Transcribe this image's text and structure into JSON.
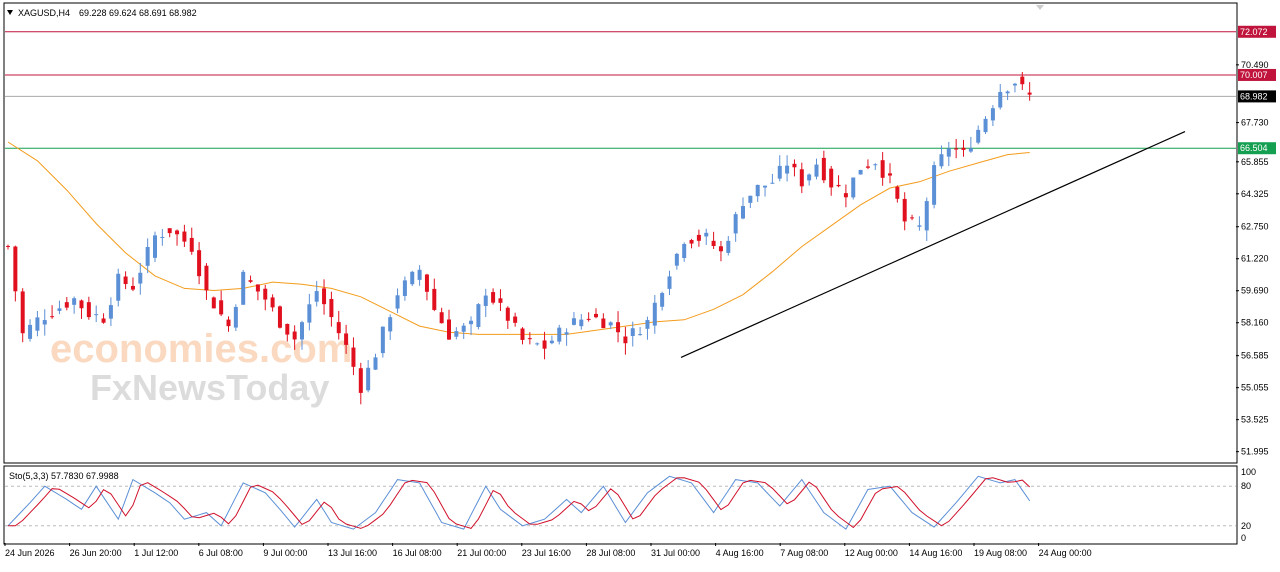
{
  "header": {
    "symbol": "XAGUSD,H4",
    "ohlc": "69.228 69.624 68.691 68.982"
  },
  "watermark": {
    "line1": "economies.com",
    "line2": "FxNewsToday"
  },
  "colors": {
    "bull": "#5b8fd6",
    "bear": "#e0101e",
    "ma": "#f39c1c",
    "resistance": "#c0143c",
    "support": "#14a050",
    "trendline": "#000000",
    "stoch_main": "#5b8fd6",
    "stoch_signal": "#d0102a"
  },
  "chart_data": [
    {
      "type": "candlestick",
      "price_axis": {
        "range": [
          51.5,
          73.4
        ],
        "ticks": [
          "70.490",
          "67.730",
          "65.855",
          "64.325",
          "62.750",
          "61.220",
          "59.690",
          "58.160",
          "56.585",
          "55.055",
          "53.525",
          "51.995"
        ]
      },
      "time_axis": {
        "labels": [
          "24 Jun 2026",
          "26 Jun 20:00",
          "1 Jul 12:00",
          "6 Jul 08:00",
          "9 Jul 00:00",
          "13 Jul 16:00",
          "16 Jul 08:00",
          "21 Jul 00:00",
          "23 Jul 16:00",
          "28 Jul 08:00",
          "31 Jul 00:00",
          "4 Aug 16:00",
          "7 Aug 08:00",
          "12 Aug 00:00",
          "14 Aug 16:00",
          "19 Aug 08:00",
          "24 Aug 00:00"
        ]
      },
      "levels": [
        {
          "price": 72.072,
          "label": "72.072",
          "role": "resistance"
        },
        {
          "price": 70.007,
          "label": "70.007",
          "role": "resistance"
        },
        {
          "price": 68.982,
          "label": "68.982",
          "role": "current"
        },
        {
          "price": 66.504,
          "label": "66.504",
          "role": "support"
        }
      ],
      "trendline": [
        [
          56.5,
          0.676
        ],
        [
          67.3,
          1.0
        ]
      ],
      "price_path": [
        [
          0,
          61.8
        ],
        [
          2,
          57.6
        ],
        [
          4,
          58.3
        ],
        [
          7,
          58.9
        ],
        [
          9,
          59.3
        ],
        [
          11,
          58.6
        ],
        [
          13,
          58.4
        ],
        [
          15,
          60.2
        ],
        [
          17,
          59.9
        ],
        [
          20,
          62.3
        ],
        [
          22,
          62.6
        ],
        [
          25,
          61.8
        ],
        [
          27,
          59.6
        ],
        [
          30,
          58.0
        ],
        [
          32,
          60.4
        ],
        [
          35,
          59.3
        ],
        [
          37,
          58.2
        ],
        [
          39,
          57.4
        ],
        [
          42,
          59.7
        ],
        [
          44,
          58.4
        ],
        [
          46,
          57.0
        ],
        [
          48,
          55.1
        ],
        [
          50,
          56.7
        ],
        [
          53,
          59.6
        ],
        [
          56,
          60.7
        ],
        [
          58,
          58.8
        ],
        [
          60,
          57.6
        ],
        [
          63,
          58.0
        ],
        [
          65,
          59.7
        ],
        [
          68,
          58.4
        ],
        [
          70,
          57.3
        ],
        [
          73,
          57.0
        ],
        [
          76,
          58.0
        ],
        [
          79,
          58.5
        ],
        [
          82,
          58.1
        ],
        [
          84,
          57.4
        ],
        [
          87,
          58.2
        ],
        [
          89,
          59.9
        ],
        [
          92,
          62.2
        ],
        [
          95,
          62.2
        ],
        [
          97,
          61.5
        ],
        [
          100,
          64.0
        ],
        [
          102,
          64.6
        ],
        [
          104,
          64.9
        ],
        [
          106,
          65.8
        ],
        [
          108,
          64.9
        ],
        [
          110,
          65.8
        ],
        [
          112,
          64.8
        ],
        [
          114,
          64.4
        ],
        [
          116,
          65.6
        ],
        [
          118,
          65.9
        ],
        [
          120,
          64.9
        ],
        [
          122,
          63.0
        ],
        [
          124,
          62.7
        ],
        [
          126,
          65.4
        ],
        [
          128,
          66.6
        ],
        [
          130,
          66.2
        ],
        [
          133,
          68.0
        ],
        [
          135,
          69.3
        ],
        [
          137,
          69.7
        ],
        [
          139,
          68.98
        ]
      ],
      "moving_average": [
        [
          0,
          66.8
        ],
        [
          4,
          65.9
        ],
        [
          8,
          64.5
        ],
        [
          12,
          62.9
        ],
        [
          16,
          61.5
        ],
        [
          20,
          60.4
        ],
        [
          24,
          59.8
        ],
        [
          28,
          59.7
        ],
        [
          32,
          59.8
        ],
        [
          36,
          60.1
        ],
        [
          40,
          60.0
        ],
        [
          44,
          59.8
        ],
        [
          48,
          59.4
        ],
        [
          52,
          58.7
        ],
        [
          56,
          58.0
        ],
        [
          60,
          57.7
        ],
        [
          64,
          57.6
        ],
        [
          68,
          57.6
        ],
        [
          72,
          57.6
        ],
        [
          76,
          57.6
        ],
        [
          80,
          57.8
        ],
        [
          84,
          58.0
        ],
        [
          88,
          58.2
        ],
        [
          92,
          58.3
        ],
        [
          96,
          58.8
        ],
        [
          100,
          59.5
        ],
        [
          104,
          60.6
        ],
        [
          108,
          61.8
        ],
        [
          112,
          62.8
        ],
        [
          116,
          63.8
        ],
        [
          120,
          64.6
        ],
        [
          124,
          64.9
        ],
        [
          128,
          65.4
        ],
        [
          132,
          65.8
        ],
        [
          136,
          66.2
        ],
        [
          139,
          66.3
        ]
      ]
    },
    {
      "type": "line",
      "indicator": "Sto(5,3,3)",
      "label": "Sto(5,3,3) 57.7830 67.9988",
      "levels": {
        "upper": "80",
        "lower": "20",
        "max": "100",
        "min": "0"
      },
      "ylim": [
        0,
        100
      ],
      "series_points": [
        [
          0,
          20
        ],
        [
          3,
          55
        ],
        [
          5,
          80
        ],
        [
          8,
          60
        ],
        [
          10,
          45
        ],
        [
          12,
          80
        ],
        [
          15,
          30
        ],
        [
          17,
          90
        ],
        [
          20,
          70
        ],
        [
          22,
          55
        ],
        [
          24,
          30
        ],
        [
          27,
          40
        ],
        [
          29,
          20
        ],
        [
          32,
          85
        ],
        [
          35,
          70
        ],
        [
          37,
          45
        ],
        [
          39,
          18
        ],
        [
          42,
          60
        ],
        [
          44,
          25
        ],
        [
          47,
          15
        ],
        [
          50,
          40
        ],
        [
          53,
          90
        ],
        [
          56,
          85
        ],
        [
          59,
          25
        ],
        [
          62,
          15
        ],
        [
          65,
          80
        ],
        [
          67,
          45
        ],
        [
          70,
          20
        ],
        [
          73,
          30
        ],
        [
          76,
          60
        ],
        [
          78,
          40
        ],
        [
          81,
          80
        ],
        [
          84,
          25
        ],
        [
          87,
          70
        ],
        [
          90,
          95
        ],
        [
          93,
          85
        ],
        [
          96,
          40
        ],
        [
          99,
          90
        ],
        [
          102,
          85
        ],
        [
          105,
          50
        ],
        [
          108,
          90
        ],
        [
          111,
          40
        ],
        [
          114,
          15
        ],
        [
          117,
          75
        ],
        [
          120,
          80
        ],
        [
          123,
          40
        ],
        [
          126,
          18
        ],
        [
          129,
          55
        ],
        [
          132,
          95
        ],
        [
          135,
          85
        ],
        [
          137,
          90
        ],
        [
          139,
          57.8
        ]
      ]
    }
  ]
}
